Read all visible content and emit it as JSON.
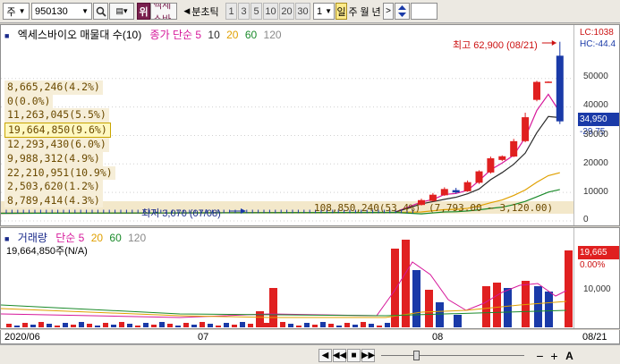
{
  "toolbar": {
    "market": "주",
    "code": "950130",
    "rank": "위",
    "stock_name": "엑세스바",
    "period_label": "분초틱",
    "minute_options": [
      "1",
      "3",
      "5",
      "10",
      "20",
      "30"
    ],
    "count_value": "1",
    "day": "일",
    "week": "주",
    "month": "월",
    "year": "년"
  },
  "price_pane": {
    "legend_title": "엑세스바이오 매물대 수(10)",
    "ma_label": "종가 단순 5",
    "ma_periods": [
      "10",
      "20",
      "60",
      "120"
    ],
    "ma_colors": [
      "#d6179a",
      "#2a2a2a",
      "#e0a000",
      "#1a8a2a",
      "#8a8a8a"
    ],
    "volume_profile": [
      {
        "value": "8,665,246(4.2%)",
        "highlight": false
      },
      {
        "value": "0(0.0%)",
        "highlight": false
      },
      {
        "value": "11,263,045(5.5%)",
        "highlight": false
      },
      {
        "value": "19,664,850(9.6%)",
        "highlight": true
      },
      {
        "value": "12,293,430(6.0%)",
        "highlight": false
      },
      {
        "value": "9,988,312(4.9%)",
        "highlight": false
      },
      {
        "value": "22,210,951(10.9%)",
        "highlight": false
      },
      {
        "value": "2,503,620(1.2%)",
        "highlight": false
      },
      {
        "value": "8,789,414(4.3%)",
        "highlight": false
      }
    ],
    "bottom_profile": "108,850,240(53.4%)",
    "bottom_range": "(7,793.00 ~ 3,120.00)",
    "high_label": "최고 62,900 (08/21)",
    "low_label": "최저 3,070 (07/08)",
    "lc_label": "LC:1038",
    "hc_label": "HC:-44.4",
    "current_price": "34,950",
    "change_pct": "-29.75",
    "y_axis": [
      "50000",
      "40000",
      "30000",
      "20000",
      "10000",
      "0"
    ]
  },
  "volume_pane": {
    "legend_title": "거래량",
    "ma_label": "단순 5",
    "ma_periods": [
      "20",
      "60",
      "120"
    ],
    "volume_text": "19,664,850주(N/A)",
    "current_volume": "19,665",
    "volume_pct": "0.00%",
    "y_axis": [
      "10,000"
    ]
  },
  "x_axis": {
    "labels": [
      "2020/06",
      "07",
      "08"
    ],
    "right_label": "08/21"
  },
  "chart_data": {
    "type": "candlestick",
    "title": "엑세스바이오",
    "ylim": [
      0,
      65000
    ],
    "periods": [
      "2020/06",
      "07",
      "08"
    ],
    "recent_candles": [
      {
        "open": 5600,
        "close": 7300,
        "high": 7800,
        "low": 5400
      },
      {
        "open": 7000,
        "close": 9200,
        "high": 9800,
        "low": 6800
      },
      {
        "open": 9000,
        "close": 11200,
        "high": 11800,
        "low": 8800
      },
      {
        "open": 10800,
        "close": 10000,
        "high": 11600,
        "low": 9600
      },
      {
        "open": 10400,
        "close": 13600,
        "high": 14200,
        "low": 10200
      },
      {
        "open": 13400,
        "close": 17400,
        "high": 17800,
        "low": 13000
      },
      {
        "open": 17000,
        "close": 22000,
        "high": 22600,
        "low": 16600
      },
      {
        "open": 21400,
        "close": 22700,
        "high": 23000,
        "low": 21000
      },
      {
        "open": 22600,
        "close": 28000,
        "high": 28800,
        "low": 22400
      },
      {
        "open": 28000,
        "close": 36400,
        "high": 38000,
        "low": 27600
      },
      {
        "open": 42500,
        "close": 48800,
        "high": 49200,
        "low": 42000
      },
      {
        "open": 48800,
        "close": 48900,
        "high": 49000,
        "low": 48600
      },
      {
        "open": 58000,
        "close": 34950,
        "high": 62900,
        "low": 34000
      }
    ],
    "volume_series_last": [
      19664850
    ]
  }
}
